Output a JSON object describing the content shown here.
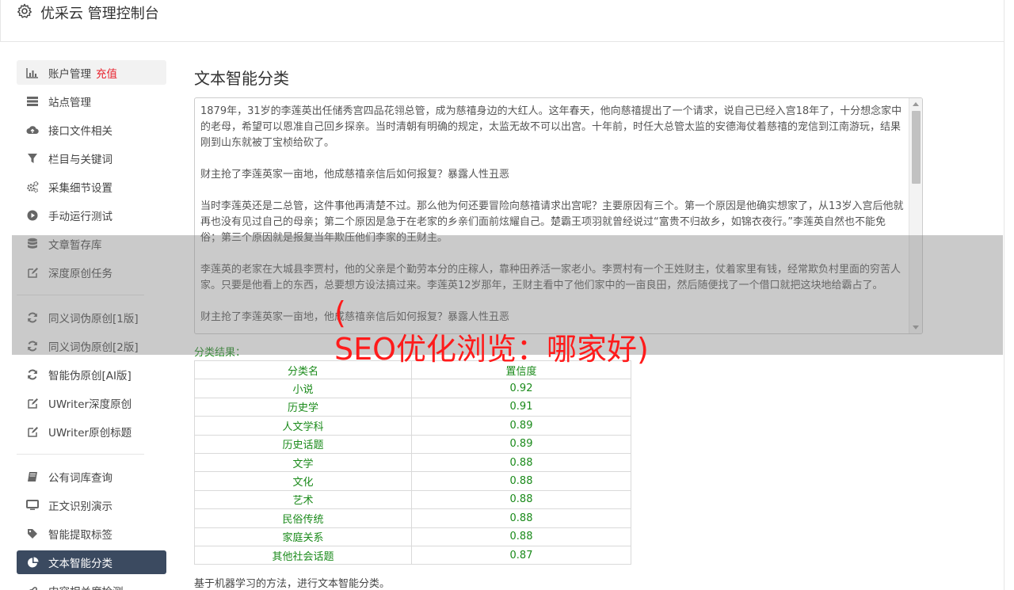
{
  "header": {
    "title": "优采云 管理控制台"
  },
  "sidebar": {
    "group1": [
      {
        "label": "账户管理",
        "badge": "充值",
        "icon": "bar-chart-icon"
      },
      {
        "label": "站点管理",
        "icon": "server-icon"
      },
      {
        "label": "接口文件相关",
        "icon": "cloud-upload-icon"
      },
      {
        "label": "栏目与关键词",
        "icon": "filter-icon"
      },
      {
        "label": "采集细节设置",
        "icon": "gears-icon"
      },
      {
        "label": "手动运行测试",
        "icon": "play-circle-icon"
      },
      {
        "label": "文章暂存库",
        "icon": "database-icon"
      },
      {
        "label": "深度原创任务",
        "icon": "edit-icon"
      }
    ],
    "group2": [
      {
        "label": "同义词伪原创[1版]",
        "icon": "refresh-icon"
      },
      {
        "label": "同义词伪原创[2版]",
        "icon": "refresh-icon"
      },
      {
        "label": "智能伪原创[AI版]",
        "icon": "refresh-icon"
      },
      {
        "label": "UWriter深度原创",
        "icon": "edit-icon"
      },
      {
        "label": "UWriter原创标题",
        "icon": "edit-icon"
      }
    ],
    "group3": [
      {
        "label": "公有词库查询",
        "icon": "book-icon"
      },
      {
        "label": "正文识别演示",
        "icon": "monitor-icon"
      },
      {
        "label": "智能提取标签",
        "icon": "tag-icon"
      },
      {
        "label": "文本智能分类",
        "icon": "pie-chart-icon"
      },
      {
        "label": "内容相关度检测",
        "icon": "link-icon"
      }
    ]
  },
  "main": {
    "title": "文本智能分类",
    "text_paragraphs": [
      "1879年，31岁的李莲英出任储秀宫四品花翎总管，成为慈禧身边的大红人。这年春天，他向慈禧提出了一个请求，说自己已经入宫18年了，十分想念家中的老母，希望可以恩准自己回乡探亲。当时清朝有明确的规定，太监无故不可以出宫。十年前，时任大总管太监的安德海仗着慈禧的宠信到江南游玩，结果刚到山东就被丁宝桢给砍了。",
      "财主抢了李莲英家一亩地，他成慈禧亲信后如何报复？暴露人性丑恶",
      "当时李莲英还是二总管，这件事他再清楚不过。那么他为何还要冒险向慈禧请求出宫呢？主要原因有三个。第一个原因是他确实想家了，从13岁入宫后他就再也没有见过自己的母亲；第二个原因是急于在老家的乡亲们面前炫耀自己。楚霸王项羽就曾经说过“富贵不归故乡，如锦衣夜行。”李莲英自然也不能免俗；第三个原因就是报复当年欺压他们李家的王财主。",
      "李莲英的老家在大城县李贾村，他的父亲是个勤劳本分的庄稼人，靠种田养活一家老小。李贾村有一个王姓财主，仗着家里有钱，经常欺负村里面的穷苦人家。只要是他看上的东西，总要想方设法搞过来。李莲英12岁那年，王财主看中了他们家中的一亩良田，然后随便找了一个借口就把这块地给霸占了。",
      "财主抢了李莲英家一亩地，他成慈禧亲信后如何报复？暴露人性丑恶"
    ],
    "result_label": "分类结果：",
    "table": {
      "headers": [
        "分类名",
        "置信度"
      ],
      "rows": [
        [
          "小说",
          "0.92"
        ],
        [
          "历史学",
          "0.91"
        ],
        [
          "人文学科",
          "0.89"
        ],
        [
          "历史话题",
          "0.89"
        ],
        [
          "文学",
          "0.88"
        ],
        [
          "文化",
          "0.88"
        ],
        [
          "艺术",
          "0.88"
        ],
        [
          "民俗传统",
          "0.88"
        ],
        [
          "家庭关系",
          "0.88"
        ],
        [
          "其他社会话题",
          "0.87"
        ]
      ]
    },
    "footnote": "基于机器学习的方法，进行文本智能分类。"
  },
  "overlay": {
    "line1": "(",
    "line2": "SEO优化浏览：哪家好)"
  },
  "colors": {
    "accent_red": "#e8222d",
    "active_nav_bg": "#3b4a60",
    "result_green": "#1a8a1a",
    "overlay_text": "#ff1b1b"
  }
}
